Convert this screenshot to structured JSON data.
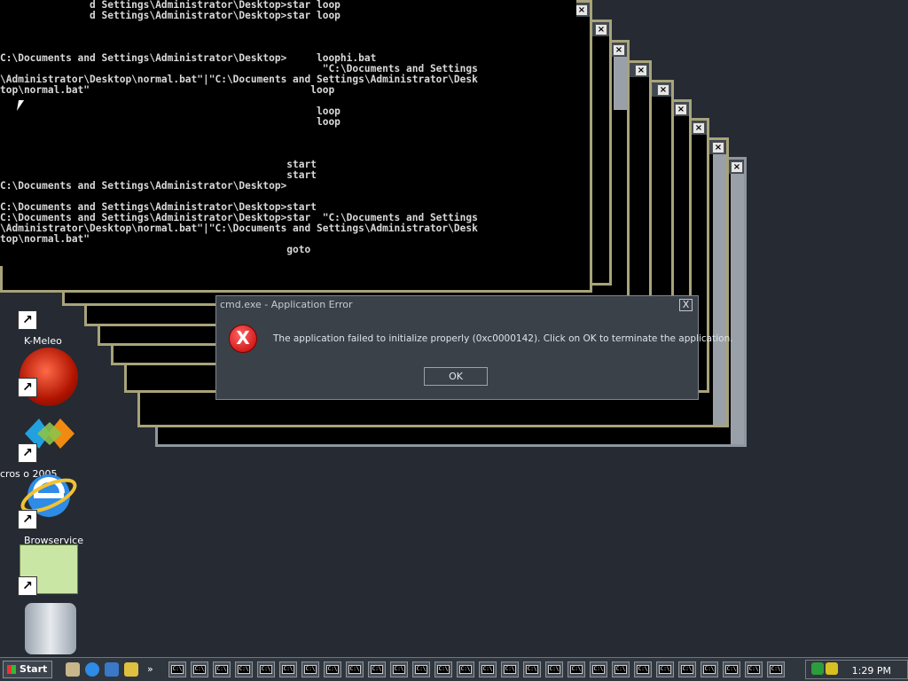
{
  "console": {
    "lines": [
      "               d Settings\\Administrator\\Desktop>star loop",
      "               d Settings\\Administrator\\Desktop>star loop",
      "",
      "",
      "",
      "C:\\Documents and Settings\\Administrator\\Desktop>     loophi.bat",
      "                                                      \"C:\\Documents and Settings",
      "\\Administrator\\Desktop\\normal.bat\"|\"C:\\Documents and Settings\\Administrator\\Desk",
      "top\\normal.bat\"                                     loop",
      "",
      "                                                     loop",
      "                                                     loop",
      "",
      "",
      "",
      "                                                start",
      "                                                start",
      "C:\\Documents and Settings\\Administrator\\Desktop>",
      "",
      "C:\\Documents and Settings\\Administrator\\Desktop>start",
      "C:\\Documents and Settings\\Administrator\\Desktop>star  \"C:\\Documents and Settings",
      "\\Administrator\\Desktop\\normal.bat\"|\"C:\\Documents and Settings\\Administrator\\Desk",
      "top\\normal.bat\"",
      "                                                goto"
    ]
  },
  "dialog": {
    "title": "cmd.exe - Application Error",
    "close_label": "X",
    "icon_glyph": "X",
    "message": "The application failed to initialize properly (0xc0000142). Click on OK to terminate the application.",
    "ok_label": "OK"
  },
  "desktop": {
    "icons": [
      {
        "label": "K-Meleo"
      },
      {
        "label": ""
      },
      {
        "label": "cros     o 2005"
      },
      {
        "label": "Browservice"
      },
      {
        "label": ""
      },
      {
        "label": ""
      }
    ]
  },
  "taskbar": {
    "start_label": "Start",
    "task_glyph": "C:\\",
    "clock": "1:29 PM"
  },
  "colors": {
    "desktop_bg": "#252a33",
    "window_border": "#a8a37a",
    "dialog_bg": "#3a4149"
  }
}
